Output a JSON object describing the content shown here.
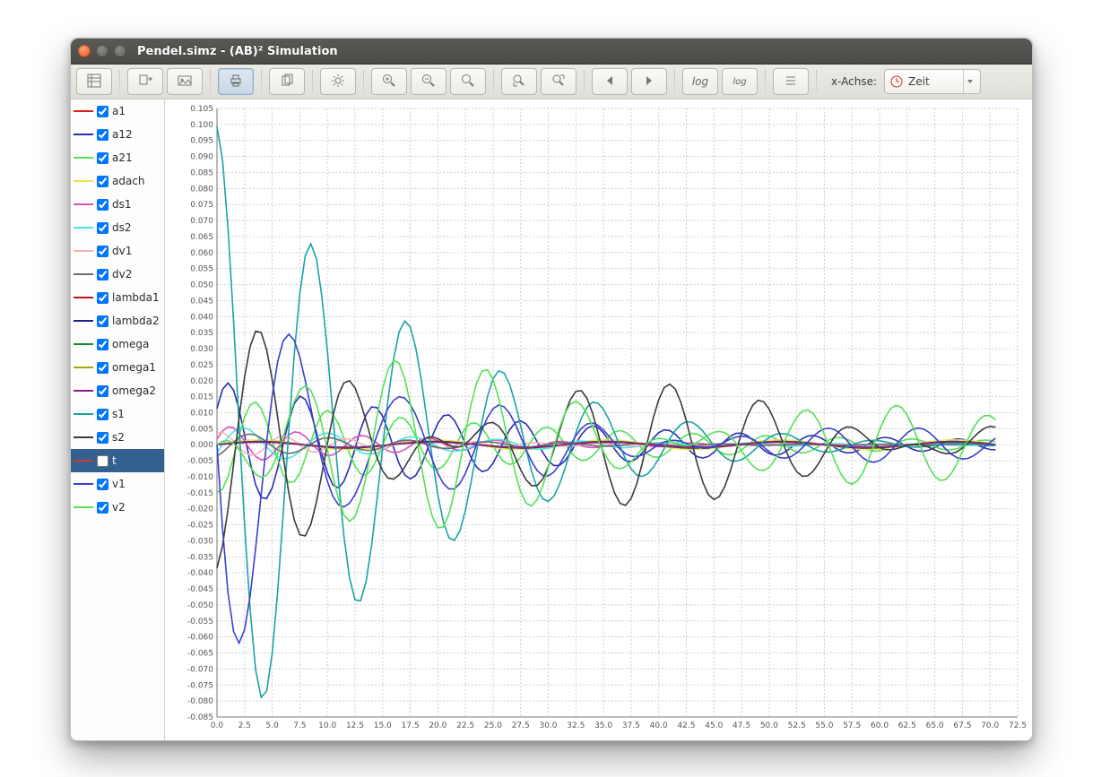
{
  "window": {
    "title": "Pendel.simz - (AB)² Simulation",
    "buttons": {
      "close": "close",
      "minimize": "minimize",
      "maximize": "maximize"
    }
  },
  "toolbar": {
    "buttons": {
      "table": {
        "name": "table-view-button",
        "icon": "table-icon"
      },
      "export": {
        "name": "export-button",
        "icon": "export-icon"
      },
      "image": {
        "name": "image-button",
        "icon": "image-icon"
      },
      "print": {
        "name": "print-button",
        "icon": "print-icon",
        "active": true
      },
      "copy": {
        "name": "copy-button",
        "icon": "copy-icon"
      },
      "settings": {
        "name": "settings-button",
        "icon": "gear-icon"
      },
      "zoom_in": {
        "name": "zoom-in-button",
        "icon": "zoom-in-icon"
      },
      "zoom_out": {
        "name": "zoom-out-button",
        "icon": "zoom-out-icon"
      },
      "zoom_fit": {
        "name": "zoom-fit-button",
        "icon": "zoom-fit-icon"
      },
      "zoom_x": {
        "name": "zoom-x-button",
        "icon": "zoom-x-icon"
      },
      "zoom_y": {
        "name": "zoom-y-button",
        "icon": "zoom-y-icon"
      },
      "prev": {
        "name": "prev-button",
        "icon": "arrow-left-icon"
      },
      "next": {
        "name": "next-button",
        "icon": "arrow-right-icon"
      },
      "log": {
        "name": "log-button",
        "icon": "log-icon",
        "text": "log"
      },
      "log2": {
        "name": "log-settings-button",
        "icon": "log-settings-icon"
      },
      "list": {
        "name": "list-button",
        "icon": "list-icon"
      }
    },
    "xaxis_label": "x-Achse:",
    "xaxis_select": {
      "label": "Zeit",
      "icon": "clock-icon"
    }
  },
  "legend": {
    "items": [
      {
        "name": "a1",
        "color": "#d9211b",
        "checked": true,
        "selected": false
      },
      {
        "name": "a12",
        "color": "#2a2fb0",
        "checked": true,
        "selected": false
      },
      {
        "name": "a21",
        "color": "#52e252",
        "checked": true,
        "selected": false
      },
      {
        "name": "adach",
        "color": "#e9e64a",
        "checked": true,
        "selected": false
      },
      {
        "name": "ds1",
        "color": "#d94fbf",
        "checked": true,
        "selected": false
      },
      {
        "name": "ds2",
        "color": "#45e6e6",
        "checked": true,
        "selected": false
      },
      {
        "name": "dv1",
        "color": "#f4b3b3",
        "checked": true,
        "selected": false
      },
      {
        "name": "dv2",
        "color": "#6b6b6b",
        "checked": true,
        "selected": false
      },
      {
        "name": "lambda1",
        "color": "#c11515",
        "checked": true,
        "selected": false
      },
      {
        "name": "lambda2",
        "color": "#1c2390",
        "checked": true,
        "selected": false
      },
      {
        "name": "omega",
        "color": "#0f8f2f",
        "checked": true,
        "selected": false
      },
      {
        "name": "omega1",
        "color": "#a8a80d",
        "checked": true,
        "selected": false
      },
      {
        "name": "omega2",
        "color": "#8a1d8a",
        "checked": true,
        "selected": false
      },
      {
        "name": "s1",
        "color": "#1aa3a3",
        "checked": true,
        "selected": false
      },
      {
        "name": "s2",
        "color": "#3b3b3b",
        "checked": true,
        "selected": false
      },
      {
        "name": "t",
        "color": "#d33a2f",
        "checked": false,
        "selected": true
      },
      {
        "name": "v1",
        "color": "#3a3fd0",
        "checked": true,
        "selected": false
      },
      {
        "name": "v2",
        "color": "#55e055",
        "checked": true,
        "selected": false
      }
    ]
  },
  "chart_data": {
    "type": "line",
    "title": "",
    "xlabel": "",
    "ylabel": "",
    "xlim": [
      0.0,
      72.5
    ],
    "ylim": [
      -0.085,
      0.105
    ],
    "xticks": [
      0.0,
      2.5,
      5.0,
      7.5,
      10.0,
      12.5,
      15.0,
      17.5,
      20.0,
      22.5,
      25.0,
      27.5,
      30.0,
      32.5,
      35.0,
      37.5,
      40.0,
      42.5,
      45.0,
      47.5,
      50.0,
      52.5,
      55.0,
      57.5,
      60.0,
      62.5,
      65.0,
      67.5,
      70.0,
      72.5
    ],
    "yticks": [
      -0.085,
      -0.08,
      -0.075,
      -0.07,
      -0.065,
      -0.06,
      -0.055,
      -0.05,
      -0.045,
      -0.04,
      -0.035,
      -0.03,
      -0.025,
      -0.02,
      -0.015,
      -0.01,
      -0.005,
      0.0,
      0.005,
      0.01,
      0.015,
      0.02,
      0.025,
      0.03,
      0.035,
      0.04,
      0.045,
      0.05,
      0.055,
      0.06,
      0.065,
      0.07,
      0.075,
      0.08,
      0.085,
      0.09,
      0.095,
      0.1,
      0.105
    ],
    "legend_position": "left",
    "grid": true,
    "x": [
      0.0,
      0.5,
      1.0,
      1.5,
      2.0,
      2.5,
      3.0,
      3.5,
      4.0,
      4.5,
      5.0,
      5.5,
      6.0,
      6.5,
      7.0,
      7.5,
      8.0,
      8.5,
      9.0,
      9.5,
      10.0,
      10.5,
      11.0,
      11.5,
      12.0,
      12.5,
      13.0,
      13.5,
      14.0,
      14.5,
      15.0,
      15.5,
      16.0,
      16.5,
      17.0,
      17.5,
      18.0,
      18.5,
      19.0,
      19.5,
      20.0,
      20.5,
      21.0,
      21.5,
      22.0,
      22.5,
      23.0,
      23.5,
      24.0,
      24.5,
      25.0,
      25.5,
      26.0,
      26.5,
      27.0,
      27.5,
      28.0,
      28.5,
      29.0,
      29.5,
      30.0,
      30.5,
      31.0,
      31.5,
      32.0,
      32.5,
      33.0,
      33.5,
      34.0,
      34.5,
      35.0,
      35.5,
      36.0,
      36.5,
      37.0,
      37.5,
      38.0,
      38.5,
      39.0,
      39.5,
      40.0,
      40.5,
      41.0,
      41.5,
      42.0,
      42.5,
      43.0,
      43.5,
      44.0,
      44.5,
      45.0,
      45.5,
      46.0,
      46.5,
      47.0,
      47.5,
      48.0,
      48.5,
      49.0,
      49.5,
      50.0,
      50.5,
      51.0,
      51.5,
      52.0,
      52.5,
      53.0,
      53.5,
      54.0,
      54.5,
      55.0,
      55.5,
      56.0,
      56.5,
      57.0,
      57.5,
      58.0,
      58.5,
      59.0,
      59.5,
      60.0,
      60.5,
      61.0,
      61.5,
      62.0,
      62.5,
      63.0,
      63.5,
      64.0,
      64.5,
      65.0,
      65.5,
      66.0,
      66.5,
      67.0,
      67.5,
      68.0,
      68.5,
      69.0,
      69.5,
      70.0,
      70.5
    ],
    "series": [
      {
        "name": "a1",
        "color": "#d9211b",
        "gen": "flat",
        "amp": 0.001,
        "freq": 0.0,
        "phase": 0.0,
        "tau": 9999
      },
      {
        "name": "a12",
        "color": "#2a2fb0",
        "gen": "dampsin",
        "amp": 0.02,
        "freq": 0.95,
        "phase": 0.6,
        "tau": 28
      },
      {
        "name": "a21",
        "color": "#52e252",
        "gen": "dampsin",
        "amp": 0.015,
        "freq": 0.95,
        "phase": -1.7,
        "tau": 30
      },
      {
        "name": "adach",
        "color": "#e9e64a",
        "gen": "flat",
        "amp": 0.0015,
        "freq": 0.0,
        "phase": 0.0,
        "tau": 9999
      },
      {
        "name": "ds1",
        "color": "#d94fbf",
        "gen": "dampsin",
        "amp": 0.006,
        "freq": 1.05,
        "phase": 0.3,
        "tau": 18
      },
      {
        "name": "ds2",
        "color": "#45e6e6",
        "gen": "dampsin",
        "amp": 0.006,
        "freq": 0.82,
        "phase": -0.4,
        "tau": 20
      },
      {
        "name": "dv1",
        "color": "#f4b3b3",
        "gen": "dampsin",
        "amp": 0.004,
        "freq": 1.1,
        "phase": 1.2,
        "tau": 16
      },
      {
        "name": "dv2",
        "color": "#6b6b6b",
        "gen": "dampsin",
        "amp": 0.004,
        "freq": 0.88,
        "phase": -1.1,
        "tau": 17
      },
      {
        "name": "lambda1",
        "color": "#c11515",
        "gen": "flat",
        "amp": 0.001,
        "freq": 0.0,
        "phase": 0.0,
        "tau": 9999
      },
      {
        "name": "lambda2",
        "color": "#1c2390",
        "gen": "flat",
        "amp": 0.001,
        "freq": 0.0,
        "phase": 0.0,
        "tau": 9999
      },
      {
        "name": "omega",
        "color": "#0f8f2f",
        "gen": "flat",
        "amp": 0.0008,
        "freq": 0.0,
        "phase": 0.0,
        "tau": 9999
      },
      {
        "name": "omega1",
        "color": "#a8a80d",
        "gen": "flat",
        "amp": 0.0008,
        "freq": 0.0,
        "phase": 0.0,
        "tau": 9999
      },
      {
        "name": "omega2",
        "color": "#8a1d8a",
        "gen": "flat",
        "amp": 0.0008,
        "freq": 0.0,
        "phase": 0.0,
        "tau": 9999
      },
      {
        "name": "s1",
        "color": "#1aa3a3",
        "gen": "special_s1"
      },
      {
        "name": "s2",
        "color": "#3b3b3b",
        "gen": "special_s2"
      },
      {
        "name": "v1",
        "color": "#3a3fd0",
        "gen": "special_v1"
      },
      {
        "name": "v2",
        "color": "#55e055",
        "gen": "special_v2"
      }
    ]
  }
}
